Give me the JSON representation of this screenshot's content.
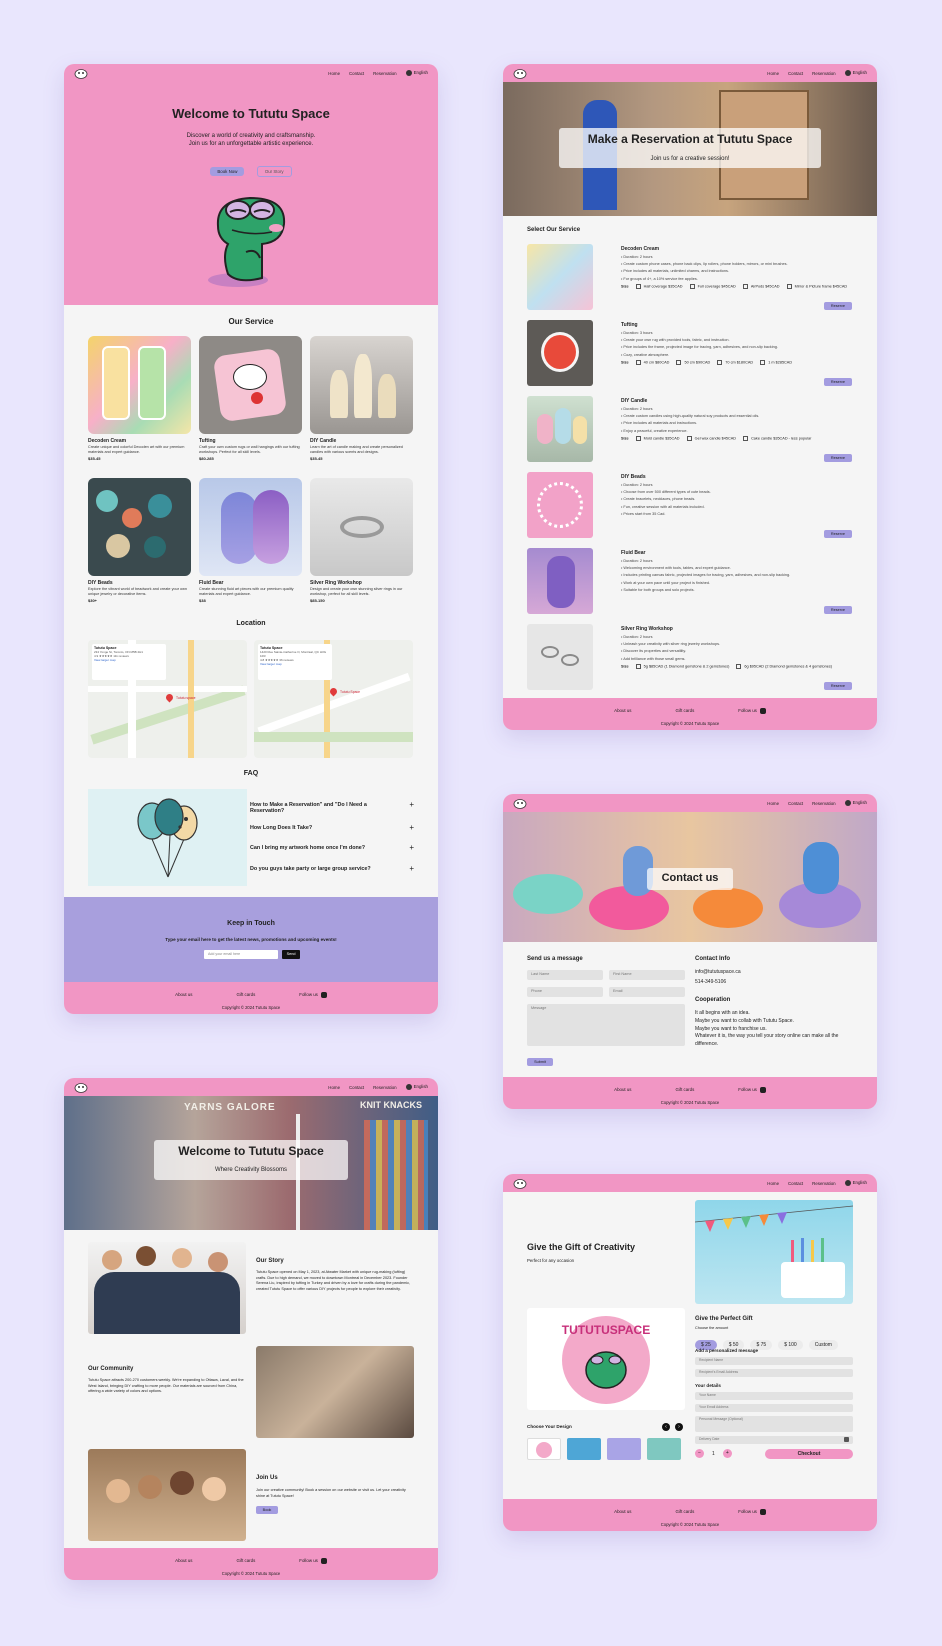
{
  "common": {
    "nav": {
      "home": "Home",
      "contact": "Contact",
      "reservation": "Reservation",
      "language": "English"
    },
    "footer": {
      "about": "About us",
      "gift": "Gift cards",
      "follow": "Follow us",
      "copyright": "Copyright © 2024 Tututu Space"
    }
  },
  "home": {
    "hero_title": "Welcome to Tututu Space",
    "hero_sub1": "Discover a world of creativity and craftsmanship.",
    "hero_sub2": "Join us for an unforgettable artistic experience.",
    "book_btn": "Book Now",
    "story_btn": "Our Story",
    "service_title": "Our Service",
    "services": [
      {
        "name": "Decoden Cream",
        "desc": "Create unique and colorful Decoden art with our premium materials and expert guidance.",
        "price": "$35-45"
      },
      {
        "name": "Tufting",
        "desc": "Craft your own custom rugs or wall hangings with our tufting workshops. Perfect for all skill levels.",
        "price": "$80-285"
      },
      {
        "name": "DIY Candle",
        "desc": "Learn the art of candle making and create personalized candles with various scents and designs.",
        "price": "$35-45"
      },
      {
        "name": "DIY Beads",
        "desc": "Explore the vibrant world of beadwork and create your own unique jewelry or decorative items.",
        "price": "$30+"
      },
      {
        "name": "Fluid Bear",
        "desc": "Create stunning fluid art pieces with our premium quality materials and expert guidance.",
        "price": "$38"
      },
      {
        "name": "Silver Ring Workshop",
        "desc": "Design and create your own stunning silver rings in our workshop, perfect for all skill levels.",
        "price": "$85-150"
      }
    ],
    "location_title": "Location",
    "maps": [
      {
        "name": "Tututu Space",
        "addr": "234 Yonge St, Toronto, ON M5B 2H1",
        "rating": "4.9 ★★★★★ 111 reviews",
        "link": "View larger map",
        "pin": "Tututu space"
      },
      {
        "name": "Tututu Space",
        "addr": "1420 Rue Sainte-Catherine O, Montréal, QC H3G 1R3",
        "rating": "4.8 ★★★★★ 36 reviews",
        "link": "View larger map",
        "pin": "Tututu Space"
      }
    ],
    "faq_title": "FAQ",
    "faqs": [
      "How to Make a Reservation\" and \"Do I Need a Reservation?",
      "How Long Does It Take?",
      "Can I bring my artwork home once I'm done?",
      "Do you guys take party or large group service?"
    ],
    "keep_title": "Keep in Touch",
    "keep_sub": "Type your email here to get the latest news, promotions and upcoming events!",
    "email_placeholder": "Add your email here",
    "send_btn": "Send"
  },
  "reservation": {
    "hero_title": "Make a Reservation at Tututu Space",
    "hero_sub": "Join us for a creative session!",
    "select_title": "Select Our Service",
    "items": [
      {
        "name": "Decoden Cream",
        "bullets": [
          "Duration: 2 hours",
          "Create custom phone cases, phone back clips, lip rollers, phone holders, mirrors, or mini brushes.",
          "Price includes all materials, unlimited charms, and instructions.",
          "For groups of 4+, a 10% service fee applies."
        ],
        "size_label": "Size",
        "sizes": [
          "Half coverage $35CAD",
          "Full coverage $45CAD",
          "AirPods $45CAD",
          "Mirror & Picture frame $45CAD"
        ],
        "btn": "Reserve"
      },
      {
        "name": "Tufting",
        "bullets": [
          "Duration: 3 hours",
          "Create your own rug with provided tools, fabric, and instruction.",
          "Price includes the frame, projected image for tracing, yarn, adhesives, and non-slip backing.",
          "Cozy, creative atmosphere."
        ],
        "size_label": "Size",
        "sizes": [
          "40 cm $80CAD",
          "50 cm $90CAD",
          "70 cm $180CAD",
          "1 m $285CAD"
        ],
        "btn": "Reserve"
      },
      {
        "name": "DIY Candle",
        "bullets": [
          "Duration: 2 hours",
          "Create custom candles using high-quality natural soy products and essential oils.",
          "Price includes all materials and instructions.",
          "Enjoy a peaceful, creative experience."
        ],
        "size_label": "Size",
        "sizes": [
          "Mold candle $35CAD",
          "Gel wax candle $45CAD",
          "Cake candle $35CAD - less popular"
        ],
        "btn": "Reserve"
      },
      {
        "name": "DIY Beads",
        "bullets": [
          "Duration: 2 hours",
          "Choose from over 500 different types of cute beads.",
          "Create bracelets, necklaces, phone beads.",
          "Fun, creative session with all materials included.",
          "Prices start from 35 Cad."
        ],
        "size_label": "",
        "sizes": [],
        "btn": "Reserve"
      },
      {
        "name": "Fluid Bear",
        "bullets": [
          "Duration: 2 hours",
          "Welcoming environment with tools, tables, and expert guidance.",
          "Includes printing canvas fabric, projected images for tracing, yarn, adhesives, and non-slip backing.",
          "Work at your own pace until your project is finished.",
          "Suitable for both groups and solo projects."
        ],
        "size_label": "",
        "sizes": [],
        "btn": "Reserve"
      },
      {
        "name": "Silver Ring Workshop",
        "bullets": [
          "Duration: 2 hours",
          "Unleash your creativity with silver ring jewelry workshops.",
          "Discover its properties and versatility.",
          "Add brilliance with those small gems."
        ],
        "size_label": "Size",
        "sizes": [
          "5g $85CAD (1 Diamond gemstone & 2 gemstones)",
          "6g $95CAD (2 Diamond gemstones & 4 gemstones)"
        ],
        "btn": "Reserve"
      }
    ]
  },
  "contact": {
    "hero_title": "Contact us",
    "send_title": "Send us a message",
    "fields": {
      "last": "Last Name",
      "first": "First Name",
      "phone": "Phone",
      "email": "Email",
      "message": "Message"
    },
    "submit": "Submit",
    "info_title": "Contact Info",
    "info_email": "info@tututuspace.ca",
    "info_phone": "514-349-5106",
    "coop_title": "Cooperation",
    "coop_lines": [
      "It all begins with an idea.",
      "Maybe you want to collab with Tututu Space.",
      "Maybe you want to franchise us.",
      "Whatever it is, the way you tell your story online can make all the difference."
    ]
  },
  "story": {
    "hero_title": "Welcome to Tututu Space",
    "hero_sub": "Where Creativity Blossoms",
    "yarn_sign": "YARNS GALORE",
    "knit_sign": "KNIT KNACKS",
    "our_story_title": "Our Story",
    "our_story_text": "Tututu Space opened on May 1, 2023, at Atwater Market with unique rug-making (tufting) crafts. Due to high demand, we moved to downtown Montreal in December 2023. Founder Serena Liu, inspired by tufting in Turkey and driven by a love for crafts during the pandemic, created Tututu Space to offer various DIY projects for people to explore their creativity.",
    "community_title": "Our Community",
    "community_text": "Tututu Space attracts 200-270 customers weekly. We're expanding to Ottawa, Laval, and the West Island, bringing DIY crafting to more people. Our materials are sourced from China, offering a wide variety of colors and options.",
    "join_title": "Join Us",
    "join_text": "Join our creative community! Book a session on our website or visit us. Let your creativity shine at Tututu Space!",
    "join_btn": "Book"
  },
  "gift": {
    "title": "Give the Gift of Creativity",
    "sub": "Perfect for any occasion",
    "logo_text": "TUTUTUSPACE",
    "perfect_title": "Give the Perfect Gift",
    "choose_amount": "Choose the amount",
    "amounts": [
      "$ 25",
      "$ 50",
      "$ 75",
      "$ 100",
      "Custom"
    ],
    "personal_title": "Add a personalized message",
    "recipient_name": "Recipient Name",
    "recipient_email": "Recipient's Email Address",
    "details_title": "Your details",
    "your_name": "Your Name",
    "your_email": "Your Email Address",
    "personal_msg": "Personal Message (Optional)",
    "delivery": "Delivery Date",
    "qty": "1",
    "minus": "−",
    "plus": "+",
    "checkout": "Checkout",
    "choose_design": "Choose Your Design"
  },
  "colors": {
    "pink": "#f196c4",
    "lavender": "#a39ce0",
    "background": "#e9e6fd",
    "card": "#f5f5f5"
  }
}
